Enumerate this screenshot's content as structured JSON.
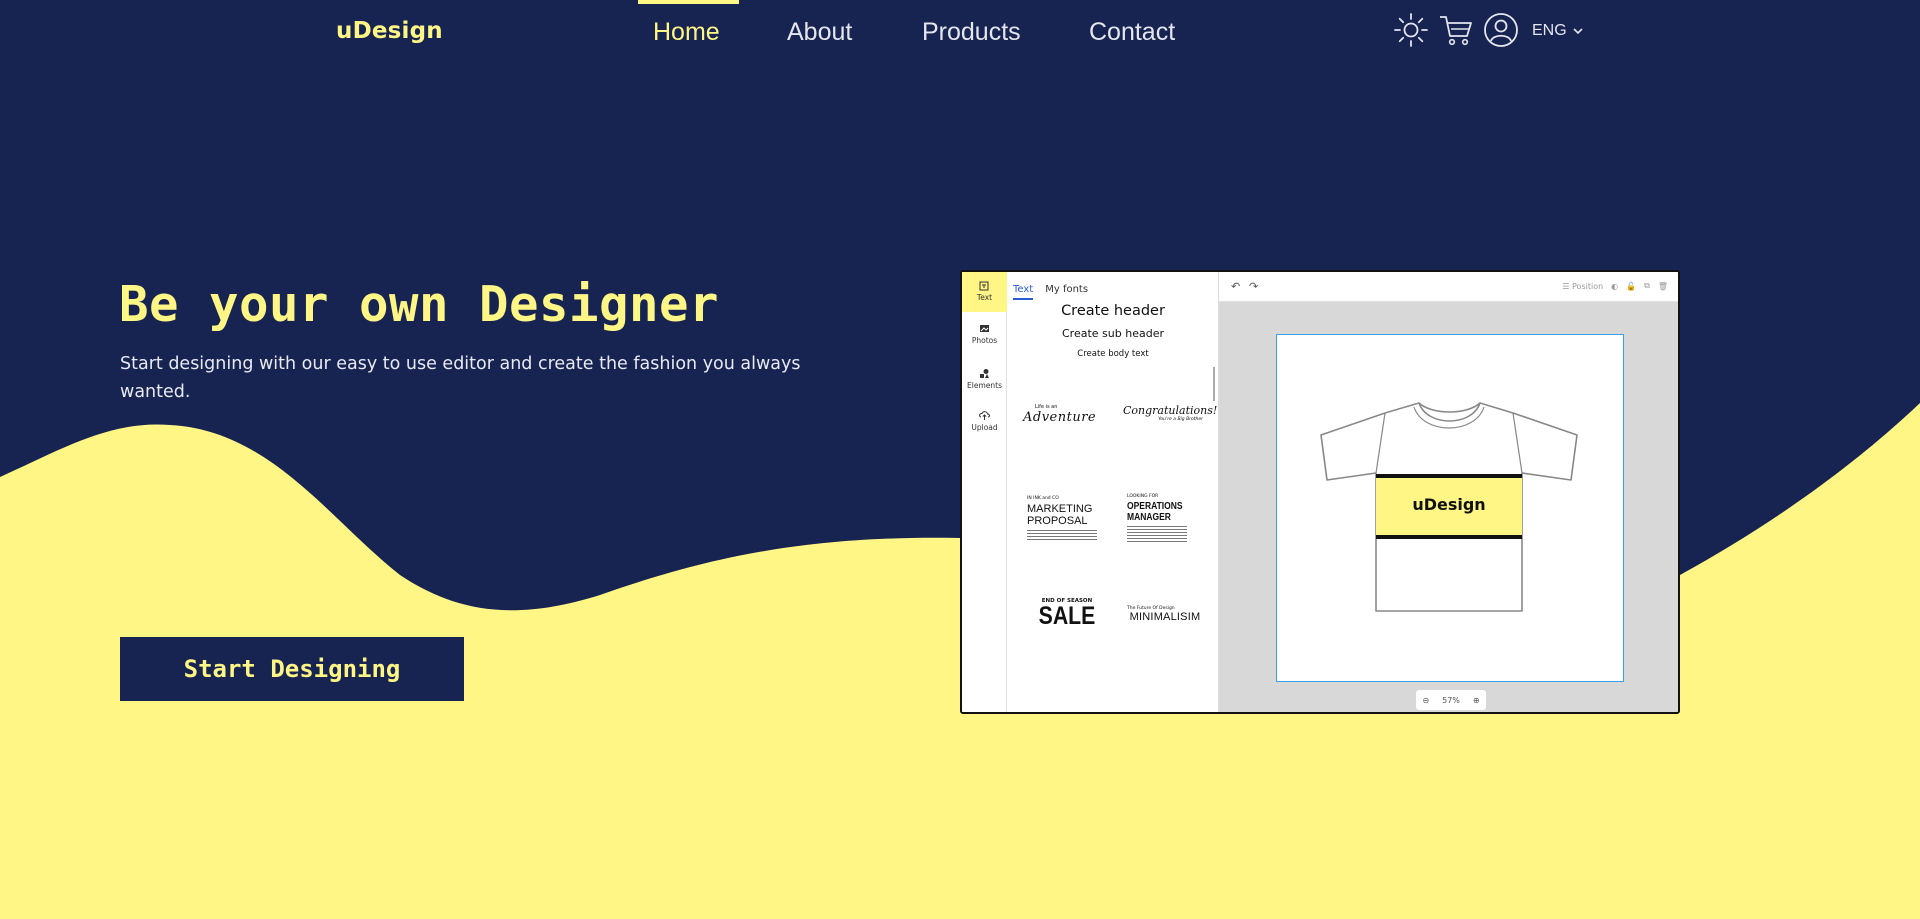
{
  "brand": {
    "logo": "uDesign"
  },
  "nav": {
    "links": [
      {
        "label": "Home"
      },
      {
        "label": "About"
      },
      {
        "label": "Products"
      },
      {
        "label": "Contact"
      }
    ],
    "icons": [
      "sun-icon",
      "cart-icon",
      "user-icon"
    ],
    "language": "ENG"
  },
  "hero": {
    "title": "Be your own Designer",
    "subtitle": "Start designing with our easy to use editor and create the fashion you always wanted.",
    "cta": "Start Designing"
  },
  "editor": {
    "rail": [
      "Text",
      "Photos",
      "Elements",
      "Upload"
    ],
    "tabs": [
      "Text",
      "My fonts"
    ],
    "create_header": "Create header",
    "create_sub_header": "Create sub header",
    "create_body_text": "Create body text",
    "templates": {
      "adventure_small": "Life is an",
      "adventure": "Adventure",
      "congrats": "Congratulations!",
      "congrats_sub": "You're a Big Brother",
      "marketing_small": "IN INK and CO",
      "marketing": "MARKETING PROPOSAL",
      "operations_small": "LOOKING FOR",
      "operations": "OPERATIONS MANAGER",
      "sale_small": "END OF SEASON",
      "sale": "SALE",
      "minimal_small": "The Future Of Design",
      "minimal": "MINIMALISIM"
    },
    "toolbar_position": "Position",
    "shirt_text": "uDesign",
    "zoom": "57%"
  },
  "colors": {
    "navy": "#172350",
    "yellow": "#fff685"
  }
}
